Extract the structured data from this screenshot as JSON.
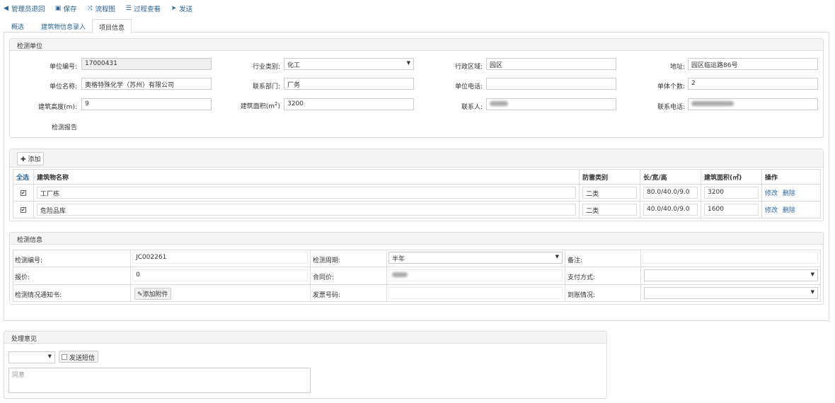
{
  "toolbar": {
    "back_label": "管理员退回",
    "save_label": "保存",
    "flow_label": "流程图",
    "process_label": "过程查看",
    "send_label": "发送"
  },
  "tabs": [
    "概选",
    "建筑物信息录入",
    "项目信息"
  ],
  "unit_panel": {
    "title": "检测单位",
    "unit_no_label": "单位编号:",
    "unit_no_value": "17000431",
    "industry_label": "行业类别:",
    "industry_value": "化工",
    "region_label": "行政区域:",
    "region_value": "园区",
    "address_label": "地址:",
    "address_value": "园区临运路86号",
    "unit_name_label": "单位名称:",
    "unit_name_value": "奥格特殊化学（苏州）有限公司",
    "dept_label": "联系部门:",
    "dept_value": "厂务",
    "phone_label": "单位电话:",
    "phone_value": "",
    "count_label": "单体个数:",
    "count_value": "2",
    "height_label": "建筑高度(m):",
    "height_value": "9",
    "area_label_pre": "建筑面积(m",
    "area_label_sup": "2",
    "area_label_post": ")",
    "area_value": "3200",
    "contact_label": "联系人:",
    "contact_phone_label": "联系电话:",
    "report_label": "检测报告"
  },
  "buildings": {
    "add_label": "添加",
    "columns": [
      "全选",
      "建筑物名称",
      "防雷类别",
      "长/宽/高",
      "建筑面积(㎡)",
      "操作"
    ],
    "rows": [
      {
        "name": "工厂栋",
        "category": "二类",
        "dims": "80.0/40.0/9.0",
        "area": "3200",
        "edit": "修改",
        "delete": "删除",
        "checked": "✔"
      },
      {
        "name": "危险品库",
        "category": "二类",
        "dims": "40.0/40.0/9.0",
        "area": "1600",
        "edit": "修改",
        "delete": "删除",
        "checked": "✔"
      }
    ]
  },
  "inspect_panel": {
    "title": "检测信息",
    "no_label": "检测编号:",
    "no_value": "JC002261",
    "cycle_label": "检测周期:",
    "cycle_value": "半年",
    "remark_label": "备注:",
    "quote_label": "报价:",
    "quote_value": "0",
    "contract_label": "合同价:",
    "pay_label": "支付方式:",
    "notice_label": "检测情况通知书:",
    "attach_label": "添加附件",
    "invoice_label": "发票号码:",
    "arrival_label": "到账情况:"
  },
  "opinion_panel": {
    "title": "处理意见",
    "sms_label": "发送短信",
    "placeholder": "同意"
  }
}
